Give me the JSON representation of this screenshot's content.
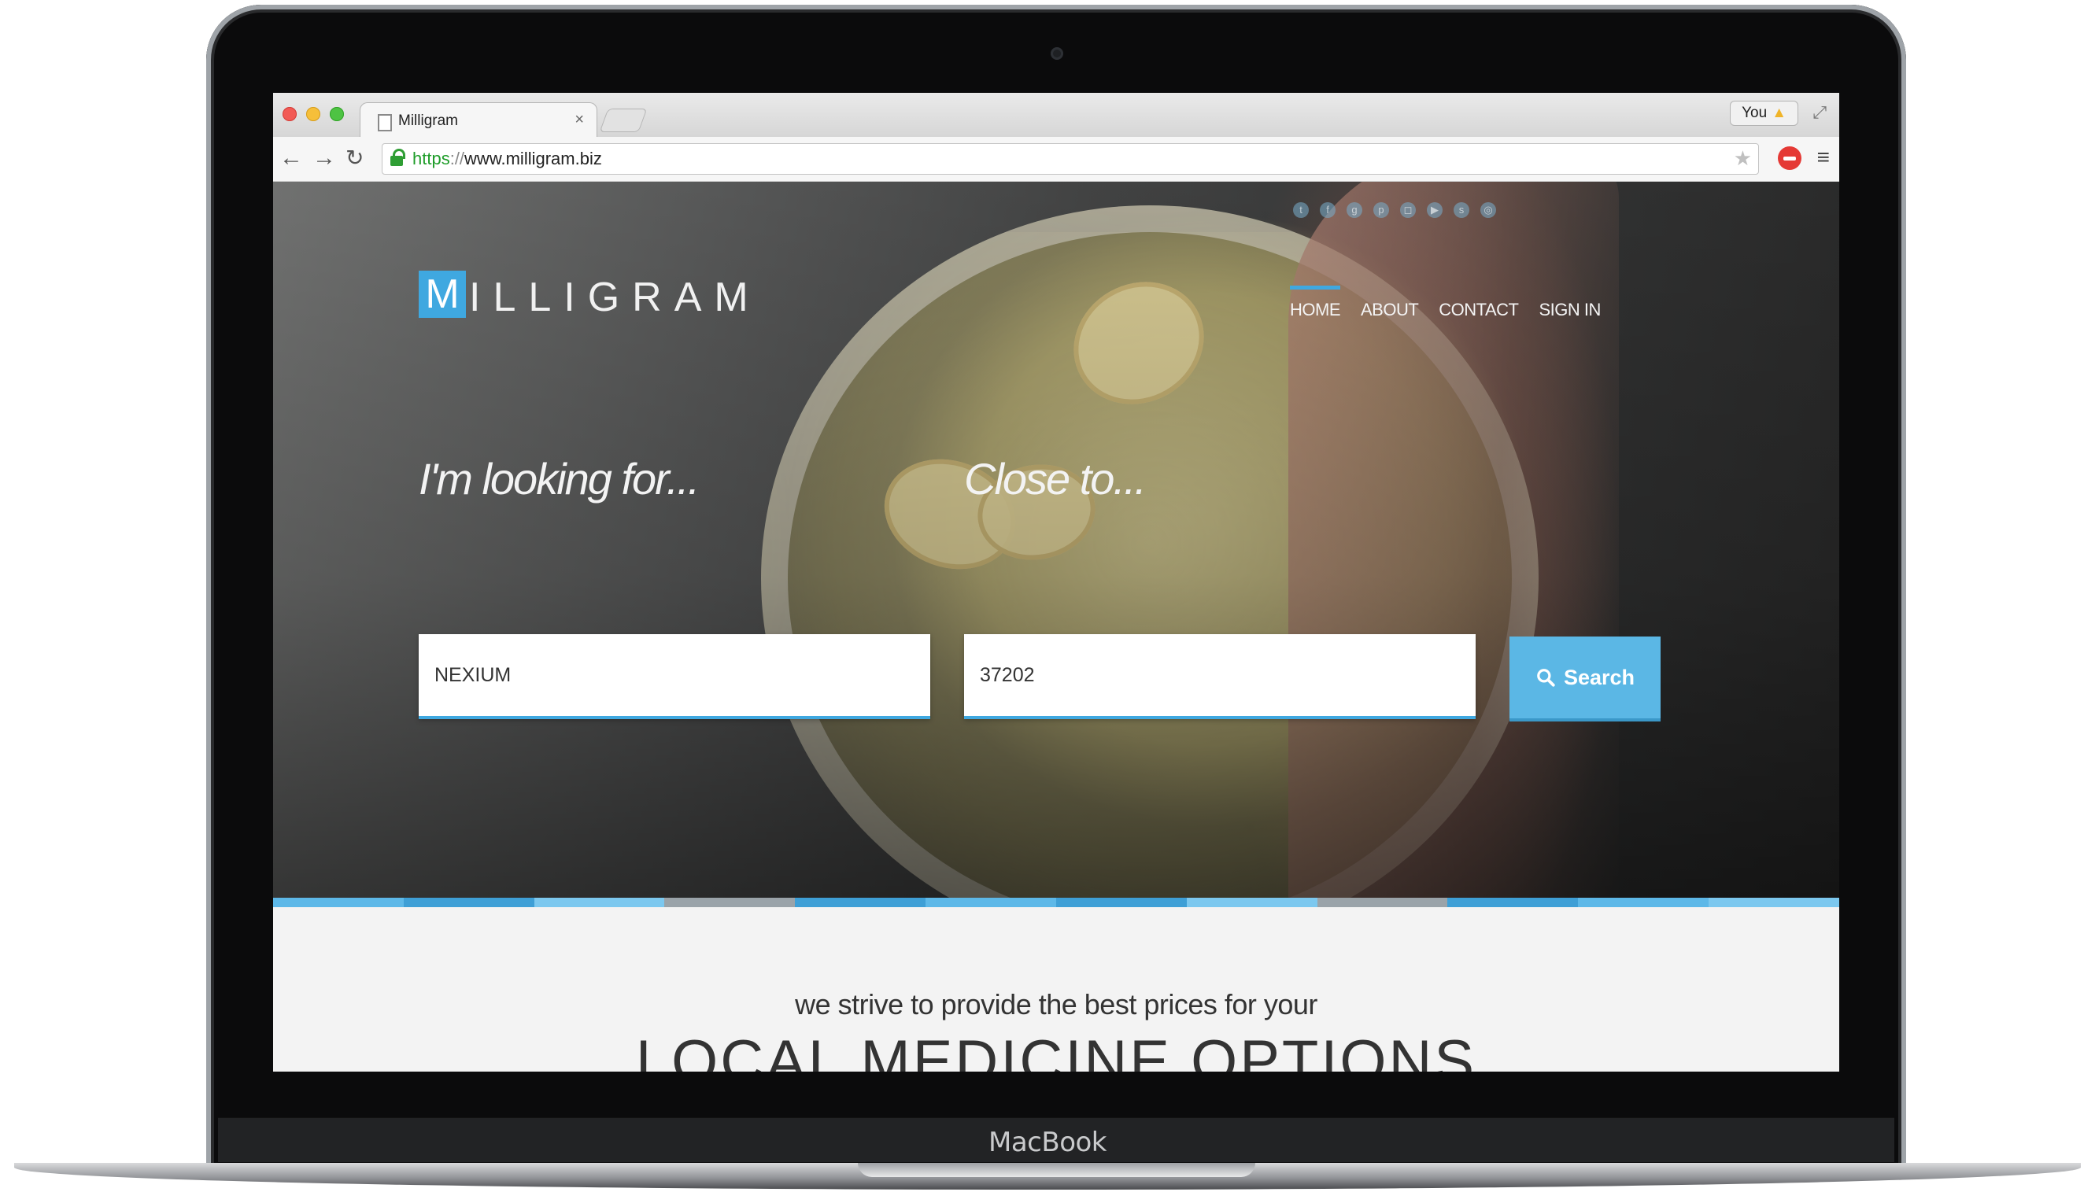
{
  "device": {
    "brand": "MacBook"
  },
  "browser": {
    "tab_title": "Milligram",
    "tab_close": "×",
    "profile_label": "You",
    "url_scheme": "https",
    "url_separator": "://",
    "url_host": "www.milligram.biz"
  },
  "site": {
    "logo_letter": "M",
    "logo_rest": "ILLIGRAM",
    "nav": [
      {
        "label": "HOME",
        "active": true
      },
      {
        "label": "ABOUT",
        "active": false
      },
      {
        "label": "CONTACT",
        "active": false
      },
      {
        "label": "SIGN IN",
        "active": false
      }
    ],
    "social_icons": [
      "twitter-icon",
      "facebook-icon",
      "google-plus-icon",
      "pinterest-icon",
      "instagram-icon",
      "youtube-icon",
      "skype-icon",
      "dribbble-icon"
    ],
    "search": {
      "looking_label": "I'm looking for...",
      "close_label": "Close to...",
      "product_value": "NEXIUM",
      "location_value": "37202",
      "button_label": "Search"
    },
    "stripe_colors": [
      "#5db8e8",
      "#3e9fd6",
      "#7cc8ef",
      "#9aa3a9",
      "#3e9fd6",
      "#5db8e8",
      "#3e9fd6",
      "#7cc8ef",
      "#9aa3a9",
      "#3e9fd6",
      "#5db8e8",
      "#7cc8ef"
    ],
    "tagline": "we strive to provide the best prices for your",
    "headline": "LOCAL MEDICINE OPTIONS"
  },
  "colors": {
    "accent": "#3fa8e0",
    "button": "#5bb7e5"
  }
}
